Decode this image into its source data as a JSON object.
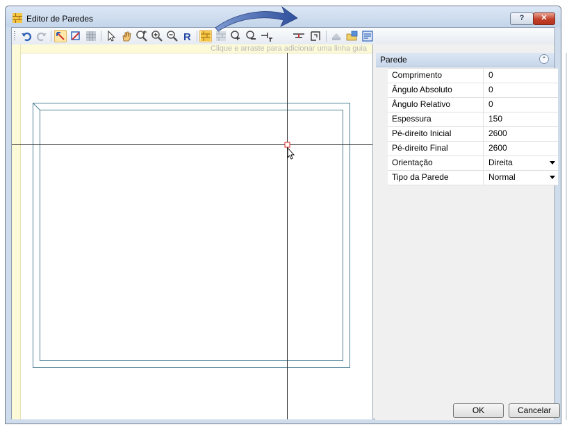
{
  "window": {
    "title": "Editor de Paredes",
    "help_label": "?",
    "close_label": "✕"
  },
  "toolbar": {
    "icons": [
      "undo-icon",
      "redo-icon",
      "draw-wall-icon",
      "edit-wall-icon",
      "grid-icon",
      "pointer-icon",
      "pan-hand-icon",
      "zoom-extents-icon",
      "zoom-in-icon",
      "zoom-out-icon",
      "redraw-icon",
      "wall-tool-icon",
      "wall-tool-disabled-icon",
      "add-node-icon",
      "remove-node-icon",
      "split-wall-icon",
      "insert-opening-icon",
      "join-walls-icon",
      "roof-icon",
      "export-icon",
      "properties-icon"
    ]
  },
  "canvas": {
    "hint": "Clique e arraste para adicionar uma linha guia"
  },
  "properties": {
    "category": "Parede",
    "rows": [
      {
        "name": "Comprimento",
        "value": "0"
      },
      {
        "name": "Ângulo Absoluto",
        "value": "0"
      },
      {
        "name": "Ângulo Relativo",
        "value": "0"
      },
      {
        "name": "Espessura",
        "value": "150"
      },
      {
        "name": "Pé-direito Inicial",
        "value": "2600"
      },
      {
        "name": "Pé-direito Final",
        "value": "2600"
      },
      {
        "name": "Orientação",
        "value": "Direita"
      },
      {
        "name": "Tipo da Parede",
        "value": "Normal"
      }
    ]
  },
  "buttons": {
    "ok": "OK",
    "cancel": "Cancelar"
  },
  "colors": {
    "wall_line": "#4a7f96",
    "guide_line": "#333333",
    "ruler": "#fdfad8",
    "accent": "#3b63b5"
  }
}
